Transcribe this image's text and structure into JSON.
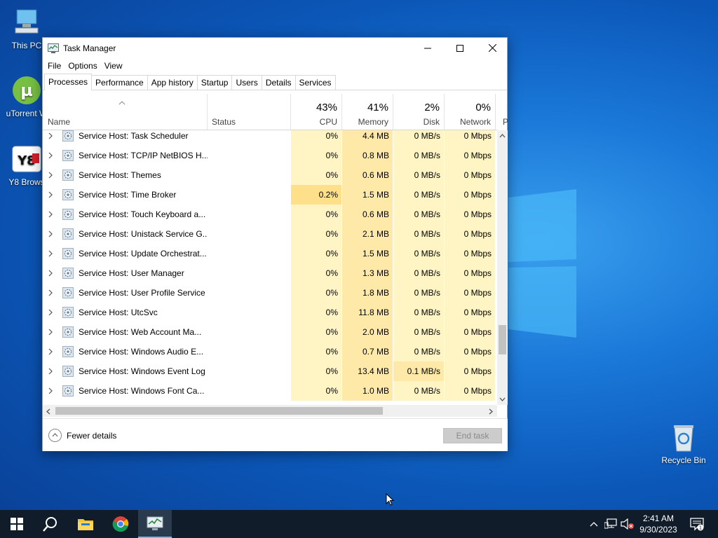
{
  "desktop": {
    "icons": [
      {
        "label": "This PC"
      },
      {
        "label": "uTorrent W"
      },
      {
        "label": "Y8 Brows"
      },
      {
        "label": "Recycle Bin"
      }
    ]
  },
  "window": {
    "title": "Task Manager",
    "menu": [
      "File",
      "Options",
      "View"
    ],
    "tabs": [
      "Processes",
      "Performance",
      "App history",
      "Startup",
      "Users",
      "Details",
      "Services"
    ],
    "active_tab": "Processes",
    "columns": {
      "name": "Name",
      "status": "Status",
      "cpu": {
        "pct": "43%",
        "label": "CPU"
      },
      "memory": {
        "pct": "41%",
        "label": "Memory"
      },
      "disk": {
        "pct": "2%",
        "label": "Disk"
      },
      "network": {
        "pct": "0%",
        "label": "Network"
      },
      "power": "P"
    },
    "rows": [
      {
        "name": "Service Host: Task Scheduler",
        "cpu": "0%",
        "mem": "4.4 MB",
        "disk": "0 MB/s",
        "net": "0 Mbps"
      },
      {
        "name": "Service Host: TCP/IP NetBIOS H...",
        "cpu": "0%",
        "mem": "0.8 MB",
        "disk": "0 MB/s",
        "net": "0 Mbps"
      },
      {
        "name": "Service Host: Themes",
        "cpu": "0%",
        "mem": "0.6 MB",
        "disk": "0 MB/s",
        "net": "0 Mbps"
      },
      {
        "name": "Service Host: Time Broker",
        "cpu": "0.2%",
        "mem": "1.5 MB",
        "disk": "0 MB/s",
        "net": "0 Mbps"
      },
      {
        "name": "Service Host: Touch Keyboard a...",
        "cpu": "0%",
        "mem": "0.6 MB",
        "disk": "0 MB/s",
        "net": "0 Mbps"
      },
      {
        "name": "Service Host: Unistack Service G...",
        "cpu": "0%",
        "mem": "2.1 MB",
        "disk": "0 MB/s",
        "net": "0 Mbps"
      },
      {
        "name": "Service Host: Update Orchestrat...",
        "cpu": "0%",
        "mem": "1.5 MB",
        "disk": "0 MB/s",
        "net": "0 Mbps"
      },
      {
        "name": "Service Host: User Manager",
        "cpu": "0%",
        "mem": "1.3 MB",
        "disk": "0 MB/s",
        "net": "0 Mbps"
      },
      {
        "name": "Service Host: User Profile Service",
        "cpu": "0%",
        "mem": "1.8 MB",
        "disk": "0 MB/s",
        "net": "0 Mbps"
      },
      {
        "name": "Service Host: UtcSvc",
        "cpu": "0%",
        "mem": "11.8 MB",
        "disk": "0 MB/s",
        "net": "0 Mbps"
      },
      {
        "name": "Service Host: Web Account Ma...",
        "cpu": "0%",
        "mem": "2.0 MB",
        "disk": "0 MB/s",
        "net": "0 Mbps"
      },
      {
        "name": "Service Host: Windows Audio E...",
        "cpu": "0%",
        "mem": "0.7 MB",
        "disk": "0 MB/s",
        "net": "0 Mbps"
      },
      {
        "name": "Service Host: Windows Event Log",
        "cpu": "0%",
        "mem": "13.4 MB",
        "disk": "0.1 MB/s",
        "net": "0 Mbps"
      },
      {
        "name": "Service Host: Windows Font Ca...",
        "cpu": "0%",
        "mem": "1.0 MB",
        "disk": "0 MB/s",
        "net": "0 Mbps"
      }
    ],
    "footer": {
      "fewer_details": "Fewer details",
      "end_task": "End task"
    }
  },
  "taskbar": {
    "items": [
      "start-icon",
      "search-icon",
      "file-explorer-icon",
      "chrome-icon",
      "task-manager-icon"
    ],
    "clock": {
      "time": "2:41 AM",
      "date": "9/30/2023"
    }
  },
  "colors": {
    "heat_low": "#fff4c4",
    "heat_mid": "#ffe9a8",
    "heat_cpu_active": "#ffe08a",
    "taskbar": "#101c2a",
    "accent": "#76b9ed"
  }
}
